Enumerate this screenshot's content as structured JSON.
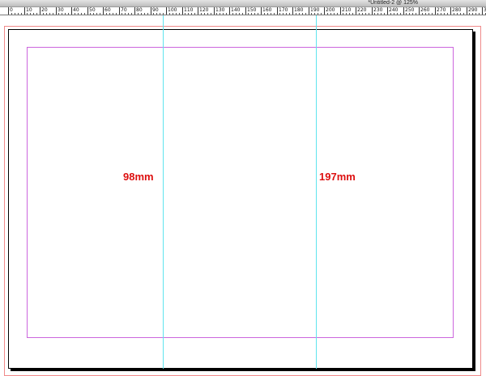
{
  "window": {
    "title": "*Untitled-2 @ 125%"
  },
  "ruler": {
    "labels": [
      "0",
      "10",
      "20",
      "30",
      "40",
      "50",
      "60",
      "70",
      "80",
      "90",
      "100",
      "110",
      "120",
      "130",
      "140",
      "150",
      "160",
      "170",
      "180",
      "190",
      "200",
      "210",
      "220",
      "230",
      "240",
      "250",
      "260",
      "270",
      "280",
      "290",
      "300"
    ]
  },
  "document": {
    "guides": {
      "left_label": "98mm",
      "right_label": "197mm"
    },
    "colors": {
      "guide": "#5fe4ee",
      "margin": "#cc66dd",
      "bleed": "#f08a8a",
      "label": "#dd1010"
    }
  }
}
